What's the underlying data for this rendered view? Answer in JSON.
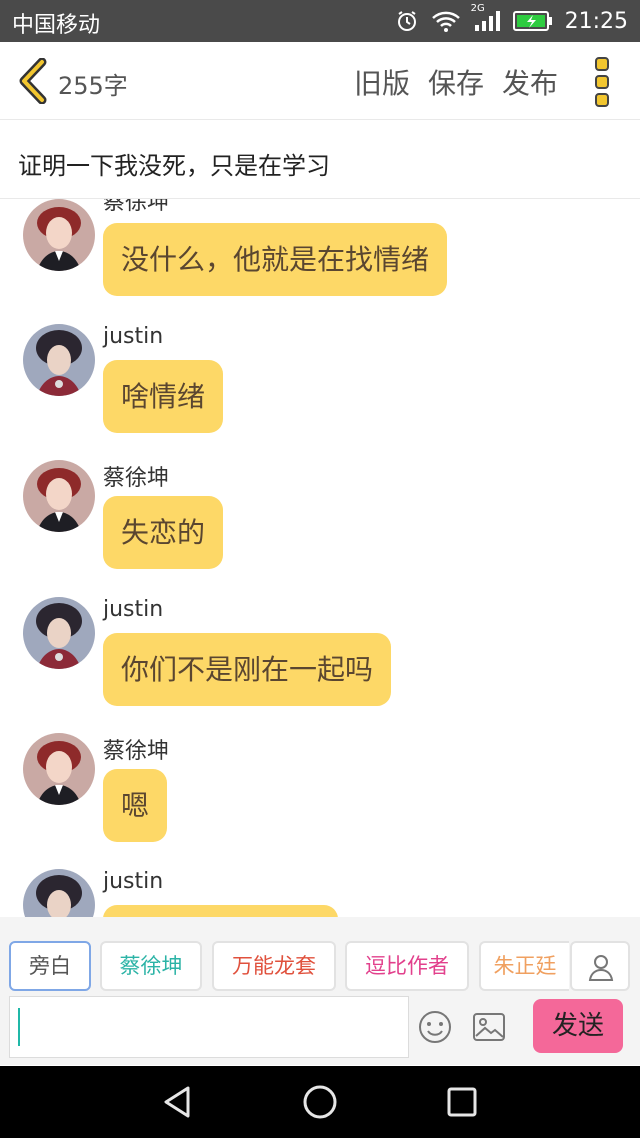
{
  "status_bar": {
    "carrier": "中国移动",
    "network": "2G",
    "time": "21:25",
    "icons": [
      "alarm-icon",
      "wifi-icon",
      "signal-icon",
      "battery-charging-icon"
    ]
  },
  "header": {
    "word_count": "255字",
    "actions": {
      "old_version": "旧版",
      "save": "保存",
      "publish": "发布"
    },
    "icons": [
      "chevron-left-icon",
      "more-vertical-icon"
    ]
  },
  "title": "证明一下我没死，只是在学习",
  "messages": [
    {
      "sender": "蔡徐坤",
      "text": "没什么，他就是在找情绪",
      "avatar": "red-hair"
    },
    {
      "sender": "justin",
      "text": "啥情绪",
      "avatar": "dark-hair"
    },
    {
      "sender": "蔡徐坤",
      "text": "失恋的",
      "avatar": "red-hair"
    },
    {
      "sender": "justin",
      "text": "你们不是刚在一起吗",
      "avatar": "dark-hair"
    },
    {
      "sender": "蔡徐坤",
      "text": "嗯",
      "avatar": "red-hair"
    },
    {
      "sender": "justin",
      "text": "",
      "avatar": "dark-hair"
    }
  ],
  "roles": [
    {
      "label": "旁白",
      "color": "#555555",
      "selected": true
    },
    {
      "label": "蔡徐坤",
      "color": "#2bb3a6",
      "selected": false
    },
    {
      "label": "万能龙套",
      "color": "#e0513d",
      "selected": false
    },
    {
      "label": "逗比作者",
      "color": "#e2408c",
      "selected": false
    },
    {
      "label": "朱正廷",
      "color": "#f0a060",
      "selected": false
    }
  ],
  "composer": {
    "input_value": "",
    "send_label": "发送",
    "icons": [
      "person-icon",
      "emoji-icon",
      "image-icon"
    ]
  },
  "colors": {
    "bubble": "#fdd867",
    "accent_yellow": "#f2c62f",
    "send_button": "#f46899",
    "status_bar": "#4a4a4a"
  },
  "nav_bar": {
    "icons": [
      "nav-back-icon",
      "nav-home-icon",
      "nav-recent-icon"
    ]
  }
}
